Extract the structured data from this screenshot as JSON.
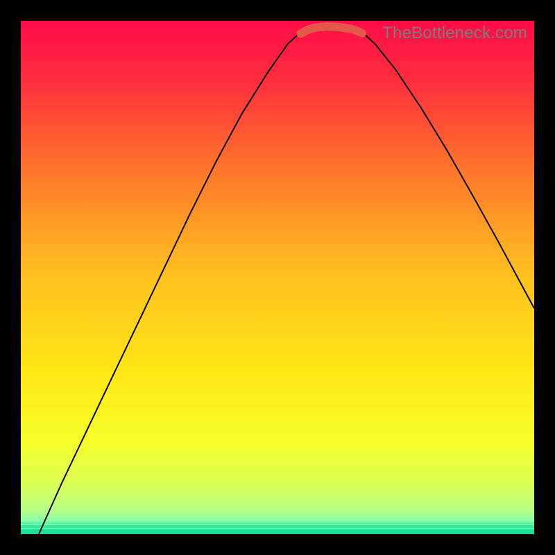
{
  "watermark": "TheBottleneck.com",
  "chart_data": {
    "type": "line",
    "title": "",
    "xlabel": "",
    "ylabel": "",
    "xlim": [
      0,
      1
    ],
    "ylim": [
      0,
      1
    ],
    "background_gradient": {
      "description": "vertical rainbow gradient red→orange→yellow→green with thin green band at bottom",
      "stops": [
        {
          "pos": 0.0,
          "color": "#ff0b47"
        },
        {
          "pos": 0.12,
          "color": "#ff2f3d"
        },
        {
          "pos": 0.3,
          "color": "#ff7a2a"
        },
        {
          "pos": 0.5,
          "color": "#ffc21e"
        },
        {
          "pos": 0.68,
          "color": "#ffe615"
        },
        {
          "pos": 0.82,
          "color": "#f6ff2a"
        },
        {
          "pos": 0.9,
          "color": "#dcff55"
        },
        {
          "pos": 0.955,
          "color": "#b5ff8a"
        },
        {
          "pos": 0.985,
          "color": "#6cffb0"
        },
        {
          "pos": 1.0,
          "color": "#22e39a"
        }
      ]
    },
    "series": [
      {
        "name": "curve-black",
        "stroke": "#000000",
        "stroke_width": 2,
        "x": [
          0.035,
          0.08,
          0.13,
          0.18,
          0.23,
          0.28,
          0.33,
          0.38,
          0.43,
          0.48,
          0.52,
          0.545,
          0.565,
          0.6,
          0.645,
          0.665,
          0.69,
          0.73,
          0.78,
          0.83,
          0.88,
          0.93,
          1.0
        ],
        "y": [
          0.0,
          0.1,
          0.205,
          0.31,
          0.415,
          0.52,
          0.625,
          0.725,
          0.818,
          0.898,
          0.955,
          0.978,
          0.985,
          0.99,
          0.985,
          0.978,
          0.955,
          0.905,
          0.83,
          0.748,
          0.66,
          0.57,
          0.44
        ]
      },
      {
        "name": "flat-band-red",
        "stroke": "#e4584b",
        "stroke_width": 12,
        "linecap": "round",
        "x": [
          0.545,
          0.56,
          0.575,
          0.595,
          0.62,
          0.645,
          0.665
        ],
        "y": [
          0.975,
          0.983,
          0.987,
          0.989,
          0.988,
          0.984,
          0.976
        ]
      }
    ]
  }
}
